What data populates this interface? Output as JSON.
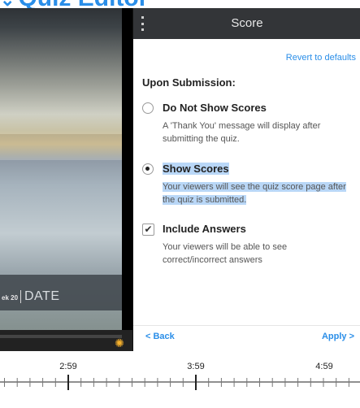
{
  "app": {
    "title": "Quiz Editor"
  },
  "video": {
    "overlay_text": "DATE",
    "overlay_small": "ek 20"
  },
  "panel": {
    "title": "Score",
    "revert_label": "Revert to defaults",
    "section_title": "Upon Submission:",
    "options": [
      {
        "label": "Do Not Show Scores",
        "desc_lines": [
          "A 'Thank You' message will display after",
          "submitting the quiz."
        ],
        "selected": false
      },
      {
        "label": "Show Scores",
        "desc_lines": [
          "Your viewers will see the quiz score page after",
          "the quiz is submitted."
        ],
        "selected": true
      }
    ],
    "checkbox": {
      "label": "Include Answers",
      "desc_lines": [
        "Your viewers will be able to see",
        "correct/incorrect answers"
      ],
      "checked": true
    },
    "footer": {
      "back_label": "< Back",
      "apply_label": "Apply >"
    }
  },
  "timeline": {
    "labels": [
      "2:59",
      "3:59",
      "4:59"
    ]
  },
  "colors": {
    "accent": "#2a8ee8",
    "header_bg": "#333538",
    "highlight": "#b9d7f7"
  },
  "icons": {
    "menu": "vertical-dots-icon",
    "loading": "loading-spinner-icon",
    "check": "checkmark-icon"
  }
}
